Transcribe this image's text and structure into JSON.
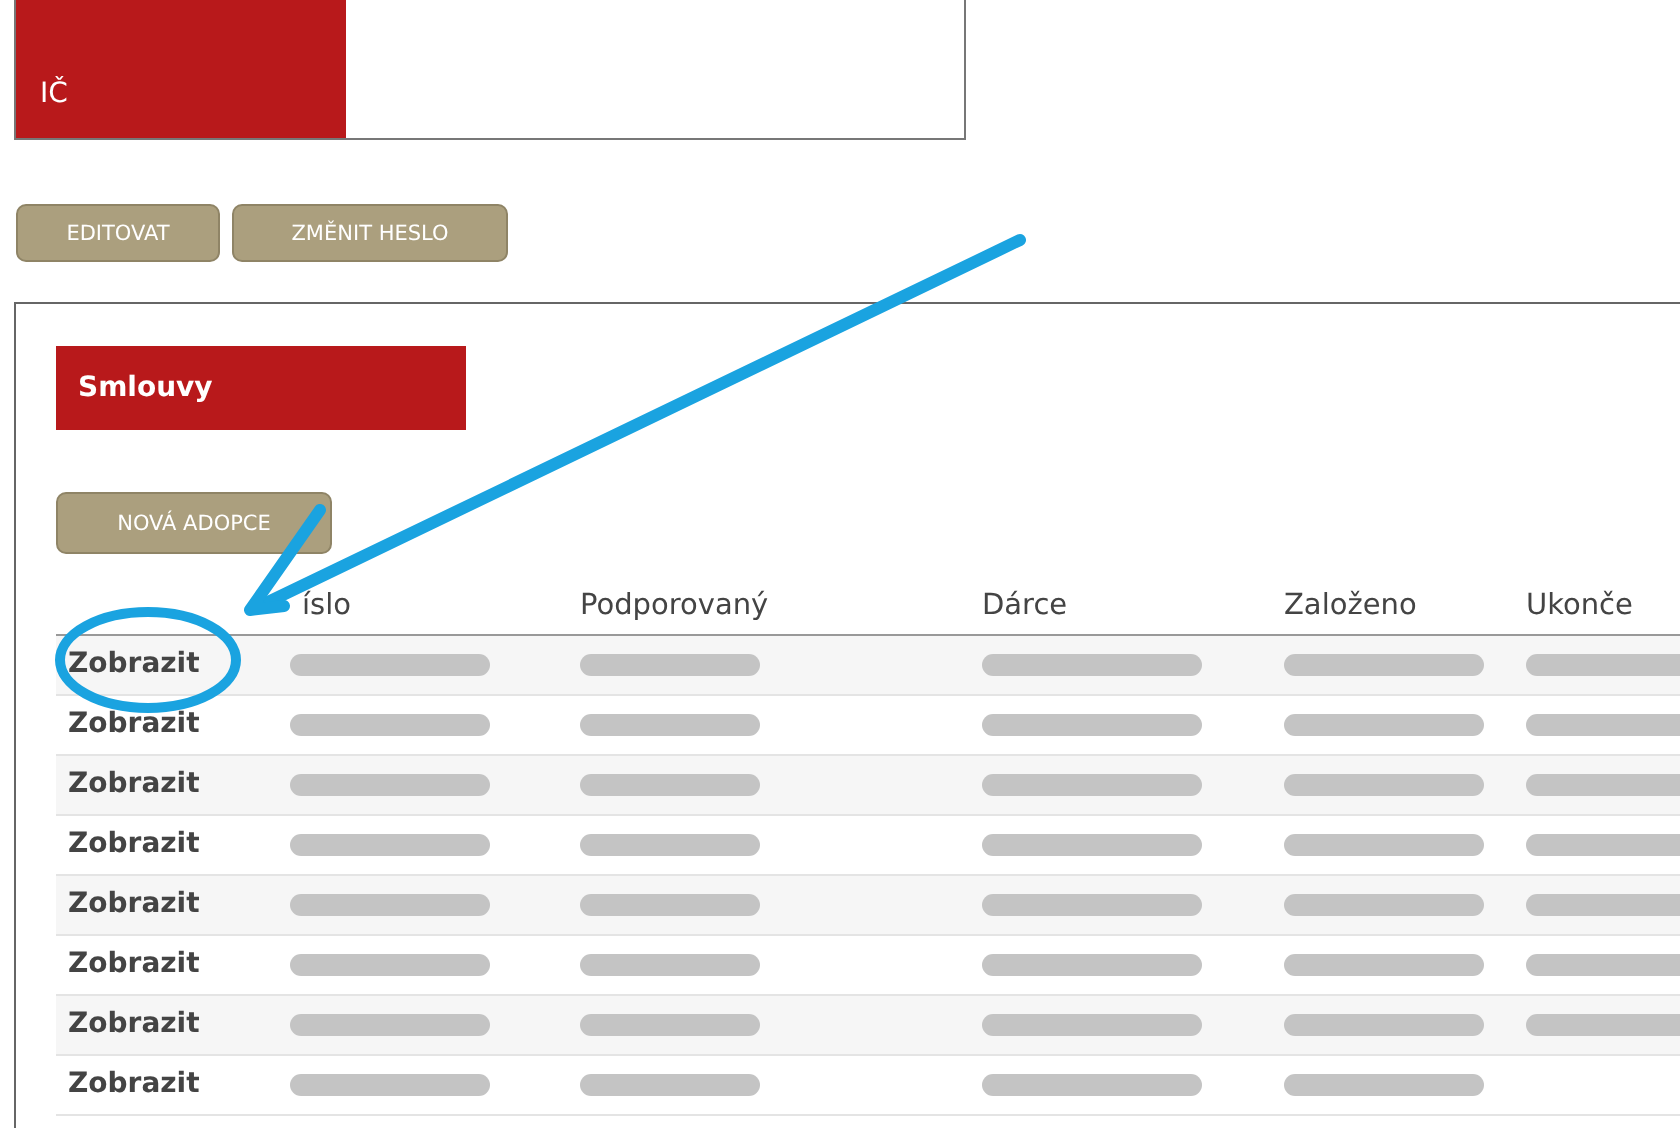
{
  "profile": {
    "fields": [
      {
        "label": "IČ"
      }
    ]
  },
  "buttons": [
    "EDITOVAT",
    "ZMĚNIT HESLO"
  ],
  "contracts": {
    "title": "Smlouvy",
    "new_button": "NOVÁ ADOPCE",
    "columns": [
      "",
      "íslo",
      "Podporovaný",
      "Dárce",
      "Založeno",
      "Ukonče"
    ],
    "rows": [
      {
        "action": "Zobrazit",
        "cells": [
          {
            "kind": "redacted"
          },
          {
            "kind": "redacted"
          },
          {
            "kind": "redacted"
          },
          {
            "kind": "redacted"
          },
          {
            "kind": "redacted"
          }
        ]
      },
      {
        "action": "Zobrazit",
        "cells": [
          {
            "kind": "redacted"
          },
          {
            "kind": "redacted"
          },
          {
            "kind": "redacted"
          },
          {
            "kind": "redacted"
          },
          {
            "kind": "redacted"
          }
        ]
      },
      {
        "action": "Zobrazit",
        "cells": [
          {
            "kind": "redacted"
          },
          {
            "kind": "redacted"
          },
          {
            "kind": "redacted"
          },
          {
            "kind": "redacted"
          },
          {
            "kind": "redacted"
          }
        ]
      },
      {
        "action": "Zobrazit",
        "cells": [
          {
            "kind": "redacted"
          },
          {
            "kind": "redacted"
          },
          {
            "kind": "redacted"
          },
          {
            "kind": "redacted"
          },
          {
            "kind": "redacted"
          }
        ]
      },
      {
        "action": "Zobrazit",
        "cells": [
          {
            "kind": "redacted"
          },
          {
            "kind": "redacted"
          },
          {
            "kind": "redacted"
          },
          {
            "kind": "redacted"
          },
          {
            "kind": "redacted"
          }
        ]
      },
      {
        "action": "Zobrazit",
        "cells": [
          {
            "kind": "redacted"
          },
          {
            "kind": "redacted"
          },
          {
            "kind": "redacted"
          },
          {
            "kind": "redacted"
          },
          {
            "kind": "redacted"
          }
        ]
      },
      {
        "action": "Zobrazit",
        "cells": [
          {
            "kind": "redacted"
          },
          {
            "kind": "redacted"
          },
          {
            "kind": "redacted"
          },
          {
            "kind": "redacted"
          },
          {
            "kind": "redacted"
          }
        ]
      },
      {
        "action": "Zobrazit",
        "cells": [
          {
            "kind": "redacted"
          },
          {
            "kind": "redacted"
          },
          {
            "kind": "redacted"
          },
          {
            "kind": "redacted"
          },
          {
            "kind": "empty"
          }
        ]
      }
    ]
  }
}
